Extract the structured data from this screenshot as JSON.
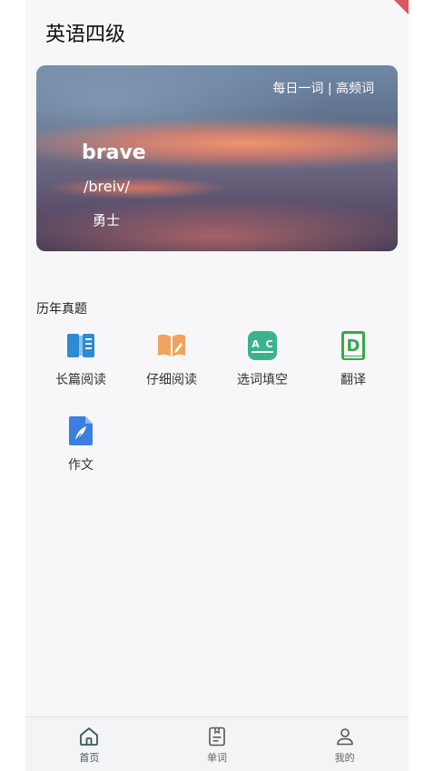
{
  "app": {
    "title": "英语四级"
  },
  "daily_card": {
    "tag": "每日一词 | 高频词",
    "word": "brave",
    "phonetic": "/breiv/",
    "meaning": "勇士"
  },
  "section": {
    "title": "历年真题"
  },
  "exam_items": [
    {
      "label": "长篇阅读",
      "icon": "open-book-icon",
      "color": "#2f8ad6"
    },
    {
      "label": "仔细阅读",
      "icon": "reading-book-icon",
      "color": "#f0a35c"
    },
    {
      "label": "选词填空",
      "icon": "fill-blank-icon",
      "color": "#3cb28c"
    },
    {
      "label": "翻译",
      "icon": "dictionary-icon",
      "color": "#36a84a"
    },
    {
      "label": "作文",
      "icon": "quill-document-icon",
      "color": "#3d7fe0"
    }
  ],
  "tabbar": {
    "items": [
      {
        "label": "首页",
        "icon": "home-icon",
        "active": true
      },
      {
        "label": "单词",
        "icon": "vocabulary-icon",
        "active": false
      },
      {
        "label": "我的",
        "icon": "user-icon",
        "active": false
      }
    ],
    "active_color": "#3f5560",
    "inactive_color": "#666666"
  }
}
